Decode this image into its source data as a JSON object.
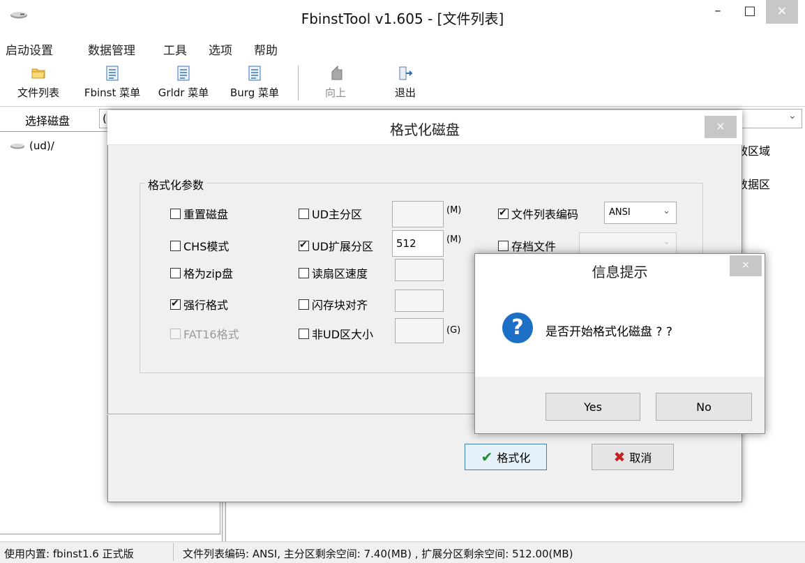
{
  "window": {
    "title": "FbinstTool v1.605 - [文件列表]",
    "minimize": "–",
    "maximize": "□",
    "close": "×"
  },
  "menu": [
    "启动设置",
    "数据管理",
    "工具",
    "选项",
    "帮助"
  ],
  "toolbar": {
    "file_list": "文件列表",
    "fbinst_menu": "Fbinst 菜单",
    "grldr_menu": "Grldr 菜单",
    "burg_menu": "Burg 菜单",
    "up": "向上",
    "exit": "退出"
  },
  "disk": {
    "label": "选择磁盘",
    "selected_partial": "(",
    "chevron": "⌄"
  },
  "tree": {
    "root": "(ud)/"
  },
  "right_pane": {
    "col1_partial": "效区域",
    "col2_partial": "数据区"
  },
  "format_dialog": {
    "title": "格式化磁盘",
    "close": "×",
    "group_title": "格式化参数",
    "options": {
      "reset_disk": {
        "label": "重置磁盘",
        "checked": false
      },
      "chs_mode": {
        "label": "CHS模式",
        "checked": false
      },
      "zip_disk": {
        "label": "格为zip盘",
        "checked": false
      },
      "force_format": {
        "label": "强行格式",
        "checked": true
      },
      "fat16": {
        "label": "FAT16格式",
        "checked": false,
        "disabled": true
      },
      "ud_primary": {
        "label": "UD主分区",
        "checked": false,
        "value": "",
        "unit": "(M)"
      },
      "ud_extended": {
        "label": "UD扩展分区",
        "checked": true,
        "value": "512",
        "unit": "(M)"
      },
      "read_speed": {
        "label": "读扇区速度",
        "checked": false,
        "value": ""
      },
      "flash_align": {
        "label": "闪存块对齐",
        "checked": false,
        "value": ""
      },
      "non_ud_size": {
        "label": "非UD区大小",
        "checked": false,
        "value": "",
        "unit": "(G)"
      },
      "list_encoding": {
        "label": "文件列表编码",
        "checked": true,
        "value": "ANSI"
      },
      "archive_file": {
        "label": "存档文件",
        "checked": false,
        "value": ""
      }
    },
    "format_button": "格式化",
    "cancel_button": "取消"
  },
  "message_box": {
    "title": "信息提示",
    "close": "×",
    "text": "是否开始格式化磁盘 ? ?",
    "icon": "?",
    "yes": "Yes",
    "no": "No"
  },
  "status": {
    "left": "使用内置: fbinst1.6 正式版",
    "right": "文件列表编码: ANSI, 主分区剩余空间: 7.40(MB) , 扩展分区剩余空间: 512.00(MB)"
  },
  "colors": {
    "accent_blue": "#1c6fc4",
    "ok_green": "#1f8f2e",
    "cancel_red": "#c62020",
    "close_gray": "#c7c7c7"
  }
}
